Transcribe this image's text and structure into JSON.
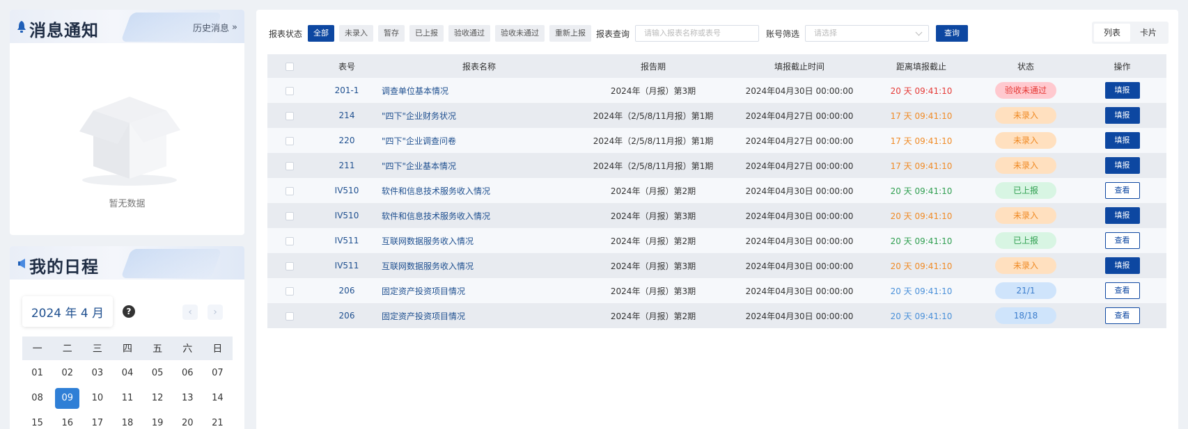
{
  "notify": {
    "title": "消息通知",
    "history": "历史消息",
    "empty": "暂无数据"
  },
  "schedule": {
    "title": "我的日程",
    "month": "2024 年 4 月",
    "help": "?",
    "prev": "‹",
    "next": "›",
    "weekdays": [
      "一",
      "二",
      "三",
      "四",
      "五",
      "六",
      "日"
    ],
    "days": [
      "01",
      "02",
      "03",
      "04",
      "05",
      "06",
      "07",
      "08",
      "09",
      "10",
      "11",
      "12",
      "13",
      "14",
      "15",
      "16",
      "17",
      "18",
      "19",
      "20",
      "21"
    ],
    "selected_day": "09"
  },
  "toolbar": {
    "status_label": "报表状态",
    "status_filters": [
      "全部",
      "未录入",
      "暂存",
      "已上报",
      "验收通过",
      "验收未通过",
      "重新上报"
    ],
    "active_filter": "全部",
    "query_label": "报表查询",
    "query_placeholder": "请输入报表名称或表号",
    "account_label": "账号筛选",
    "account_placeholder": "请选择",
    "query_button": "查询",
    "view_list": "列表",
    "view_card": "卡片"
  },
  "table": {
    "headers": [
      "表号",
      "报表名称",
      "报告期",
      "填报截止时间",
      "距离填报截止",
      "状态",
      "操作"
    ],
    "rows": [
      {
        "num": "201-1",
        "name": "调查单位基本情况",
        "period": "2024年（月报）第3期",
        "deadline": "2024年04月30日 00:00:00",
        "remain": "20 天 09:41:10",
        "remain_color": "red",
        "status": "验收未通过",
        "status_color": "red",
        "action": "填报",
        "action_type": "fill"
      },
      {
        "num": "214",
        "name": "\"四下\"企业财务状况",
        "period": "2024年（2/5/8/11月报）第1期",
        "deadline": "2024年04月27日 00:00:00",
        "remain": "17 天 09:41:10",
        "remain_color": "orange",
        "status": "未录入",
        "status_color": "orange",
        "action": "填报",
        "action_type": "fill"
      },
      {
        "num": "220",
        "name": "\"四下\"企业调查问卷",
        "period": "2024年（2/5/8/11月报）第1期",
        "deadline": "2024年04月27日 00:00:00",
        "remain": "17 天 09:41:10",
        "remain_color": "orange",
        "status": "未录入",
        "status_color": "orange",
        "action": "填报",
        "action_type": "fill"
      },
      {
        "num": "211",
        "name": "\"四下\"企业基本情况",
        "period": "2024年（2/5/8/11月报）第1期",
        "deadline": "2024年04月27日 00:00:00",
        "remain": "17 天 09:41:10",
        "remain_color": "orange",
        "status": "未录入",
        "status_color": "orange",
        "action": "填报",
        "action_type": "fill"
      },
      {
        "num": "IV510",
        "name": "软件和信息技术服务收入情况",
        "period": "2024年（月报）第2期",
        "deadline": "2024年04月30日 00:00:00",
        "remain": "20 天 09:41:10",
        "remain_color": "green",
        "status": "已上报",
        "status_color": "green",
        "action": "查看",
        "action_type": "view"
      },
      {
        "num": "IV510",
        "name": "软件和信息技术服务收入情况",
        "period": "2024年（月报）第3期",
        "deadline": "2024年04月30日 00:00:00",
        "remain": "20 天 09:41:10",
        "remain_color": "orange",
        "status": "未录入",
        "status_color": "orange",
        "action": "填报",
        "action_type": "fill"
      },
      {
        "num": "IV511",
        "name": "互联网数据服务收入情况",
        "period": "2024年（月报）第2期",
        "deadline": "2024年04月30日 00:00:00",
        "remain": "20 天 09:41:10",
        "remain_color": "green",
        "status": "已上报",
        "status_color": "green",
        "action": "查看",
        "action_type": "view"
      },
      {
        "num": "IV511",
        "name": "互联网数据服务收入情况",
        "period": "2024年（月报）第3期",
        "deadline": "2024年04月30日 00:00:00",
        "remain": "20 天 09:41:10",
        "remain_color": "orange",
        "status": "未录入",
        "status_color": "orange",
        "action": "填报",
        "action_type": "fill"
      },
      {
        "num": "206",
        "name": "固定资产投资项目情况",
        "period": "2024年（月报）第3期",
        "deadline": "2024年04月30日 00:00:00",
        "remain": "20 天 09:41:10",
        "remain_color": "blue",
        "status": "21/1",
        "status_color": "blue",
        "action": "查看",
        "action_type": "view"
      },
      {
        "num": "206",
        "name": "固定资产投资项目情况",
        "period": "2024年（月报）第2期",
        "deadline": "2024年04月30日 00:00:00",
        "remain": "20 天 09:41:10",
        "remain_color": "blue",
        "status": "18/18",
        "status_color": "blue",
        "action": "查看",
        "action_type": "view"
      }
    ]
  }
}
